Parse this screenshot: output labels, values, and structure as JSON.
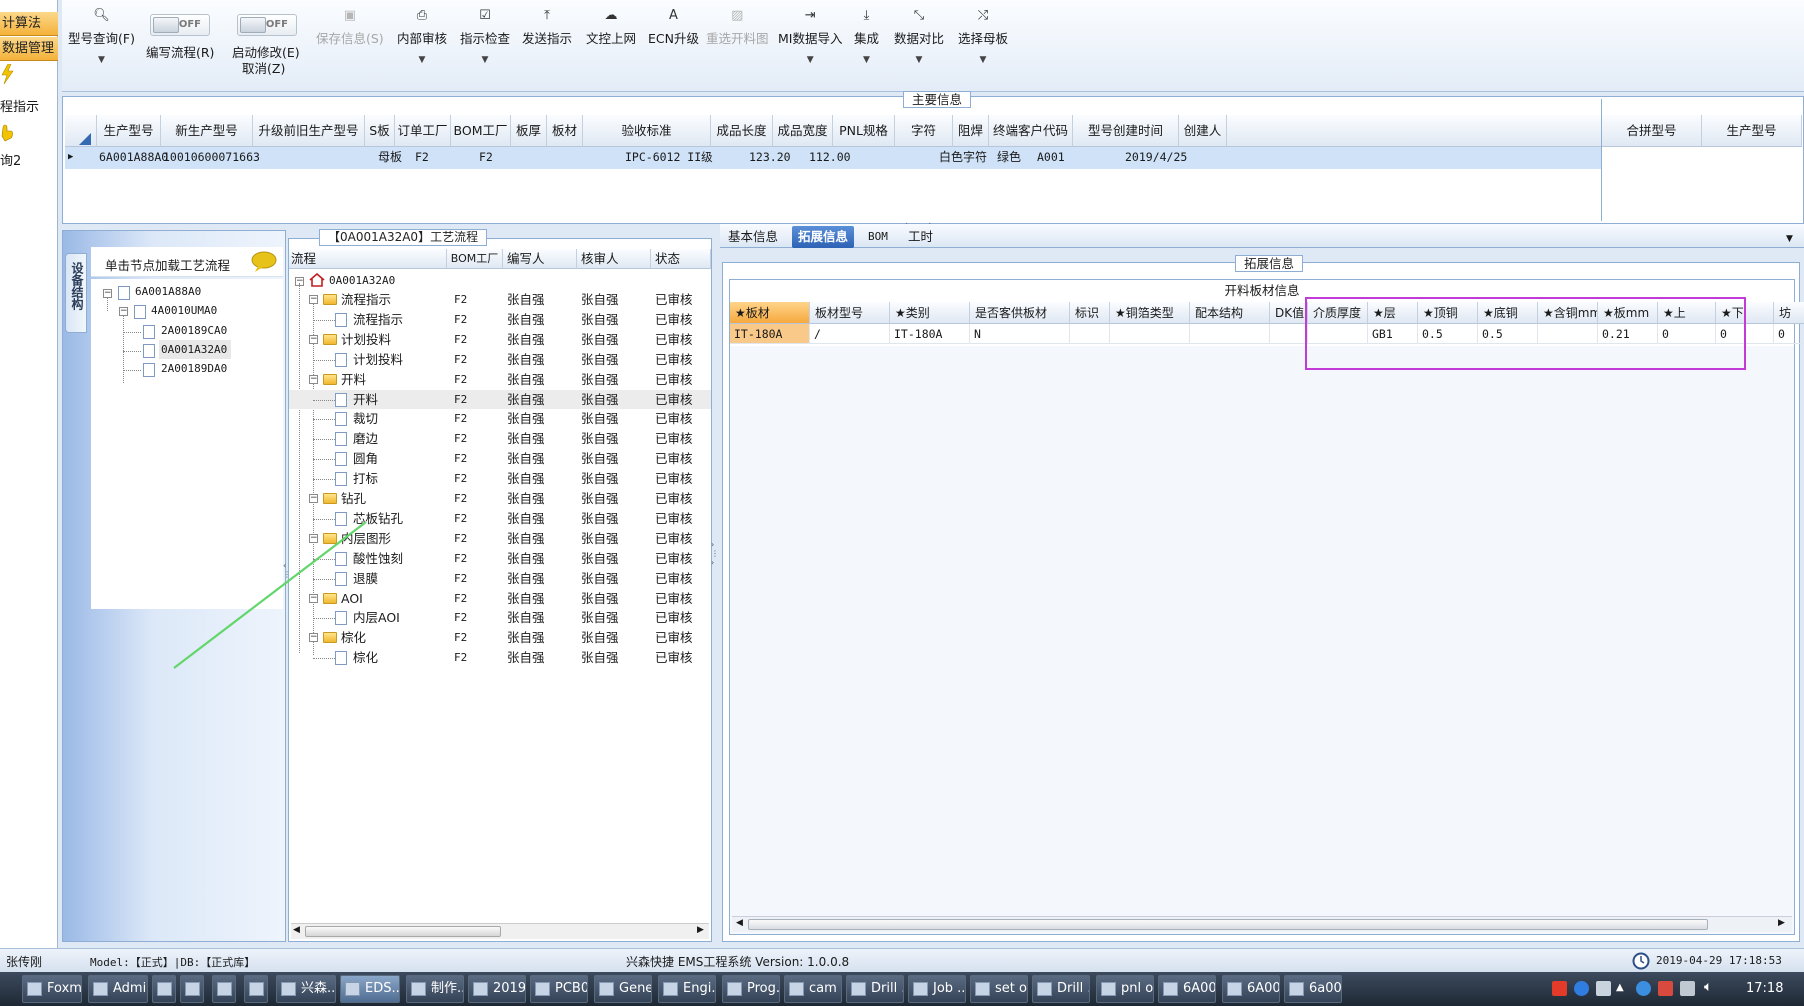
{
  "left_nav": {
    "btn1": "计算法",
    "btn2": "数据管理",
    "text1": "程指示",
    "text2": "询2"
  },
  "toolbar": {
    "items": [
      {
        "label": "型号查询(F)",
        "icon": "search-icon"
      },
      {
        "label": "编写流程(R)",
        "toggle": "OFF"
      },
      {
        "label": "启动修改(E)",
        "label2": "取消(Z)",
        "toggle": "OFF"
      },
      {
        "label": "保存信息(S)",
        "icon": "save-icon",
        "disabled": true
      },
      {
        "label": "内部审核",
        "icon": "printer-icon"
      },
      {
        "label": "指示检查",
        "icon": "check-icon"
      },
      {
        "label": "发送指示",
        "icon": "upload-icon"
      },
      {
        "label": "文控上网",
        "icon": "cloud-icon"
      },
      {
        "label": "ECN升级",
        "icon": "ecn-icon"
      },
      {
        "label": "重选开料图",
        "icon": "image-icon",
        "disabled": true
      },
      {
        "label": "MI数据导入",
        "icon": "import-icon"
      },
      {
        "label": "集成",
        "icon": "download-icon"
      },
      {
        "label": "数据对比",
        "icon": "compare-icon"
      },
      {
        "label": "选择母板",
        "icon": "shuffle-icon"
      }
    ]
  },
  "main_info": {
    "title": "主要信息",
    "headers": [
      "生产型号",
      "新生产型号",
      "升级前旧生产型号",
      "S板",
      "订单工厂",
      "BOM工厂",
      "板厚",
      "板材",
      "验收标准",
      "成品长度",
      "成品宽度",
      "PNL规格",
      "字符",
      "阻焊",
      "终端客户代码",
      "型号创建时间",
      "创建人"
    ],
    "row": {
      "prod_model": "6A001A88A0",
      "new_model": "10010600071663",
      "old_model": "",
      "s_board": "母板",
      "order_factory": "F2",
      "bom_factory": "F2",
      "thickness": "",
      "material": "",
      "standard": "IPC-6012 II级",
      "length": "123.20",
      "width": "112.00",
      "pnl": "",
      "char": "白色字符",
      "mask": "绿色",
      "customer": "A001",
      "created": "2019/4/25",
      "creator": ""
    },
    "side_headers": [
      "合拼型号",
      "生产型号"
    ]
  },
  "structure": {
    "side_tab": "设备结构",
    "hint": "单击节点加载工艺流程",
    "nodes": [
      "6A001A88A0",
      "4A0010UMA0",
      "2A00189CA0",
      "0A001A32A0",
      "2A00189DA0"
    ]
  },
  "flow": {
    "title": "【0A001A32A0】工艺流程",
    "headers": [
      "流程",
      "BOM工厂",
      "编写人",
      "核审人",
      "状态"
    ],
    "root": "0A001A32A0",
    "rows": [
      {
        "name": "流程指示",
        "bom": "F2",
        "writer": "张自强",
        "reviewer": "张自强",
        "status": "已审核"
      },
      {
        "name": "流程指示",
        "bom": "F2",
        "writer": "张自强",
        "reviewer": "张自强",
        "status": "已审核"
      },
      {
        "name": "计划投料",
        "bom": "F2",
        "writer": "张自强",
        "reviewer": "张自强",
        "status": "已审核"
      },
      {
        "name": "计划投料",
        "bom": "F2",
        "writer": "张自强",
        "reviewer": "张自强",
        "status": "已审核"
      },
      {
        "name": "开料",
        "bom": "F2",
        "writer": "张自强",
        "reviewer": "张自强",
        "status": "已审核"
      },
      {
        "name": "开料",
        "bom": "F2",
        "writer": "张自强",
        "reviewer": "张自强",
        "status": "已审核"
      },
      {
        "name": "裁切",
        "bom": "F2",
        "writer": "张自强",
        "reviewer": "张自强",
        "status": "已审核"
      },
      {
        "name": "磨边",
        "bom": "F2",
        "writer": "张自强",
        "reviewer": "张自强",
        "status": "已审核"
      },
      {
        "name": "圆角",
        "bom": "F2",
        "writer": "张自强",
        "reviewer": "张自强",
        "status": "已审核"
      },
      {
        "name": "打标",
        "bom": "F2",
        "writer": "张自强",
        "reviewer": "张自强",
        "status": "已审核"
      },
      {
        "name": "钻孔",
        "bom": "F2",
        "writer": "张自强",
        "reviewer": "张自强",
        "status": "已审核"
      },
      {
        "name": "芯板钻孔",
        "bom": "F2",
        "writer": "张自强",
        "reviewer": "张自强",
        "status": "已审核"
      },
      {
        "name": "内层图形",
        "bom": "F2",
        "writer": "张自强",
        "reviewer": "张自强",
        "status": "已审核"
      },
      {
        "name": "酸性蚀刻",
        "bom": "F2",
        "writer": "张自强",
        "reviewer": "张自强",
        "status": "已审核"
      },
      {
        "name": "退膜",
        "bom": "F2",
        "writer": "张自强",
        "reviewer": "张自强",
        "status": "已审核"
      },
      {
        "name": "AOI",
        "bom": "F2",
        "writer": "张自强",
        "reviewer": "张自强",
        "status": "已审核"
      },
      {
        "name": "内层AOI",
        "bom": "F2",
        "writer": "张自强",
        "reviewer": "张自强",
        "status": "已审核"
      },
      {
        "name": "棕化",
        "bom": "F2",
        "writer": "张自强",
        "reviewer": "张自强",
        "status": "已审核"
      },
      {
        "name": "棕化",
        "bom": "F2",
        "writer": "张自强",
        "reviewer": "张自强",
        "status": "已审核"
      }
    ]
  },
  "detail": {
    "tabs": [
      "基本信息",
      "拓展信息",
      "BOM",
      "工时"
    ],
    "group_title": "拓展信息",
    "table_title": "开料板材信息",
    "headers": [
      "★板材",
      "板材型号",
      "★类别",
      "是否客供板材",
      "标识",
      "★铜箔类型",
      "配本结构",
      "DK值",
      "介质厚度",
      "★层",
      "★顶铜",
      "★底铜",
      "★含铜mm",
      "★板mm",
      "★上",
      "★下",
      "坊"
    ],
    "row": [
      "IT-180A",
      "/",
      "IT-180A",
      "N",
      "",
      "",
      "",
      "",
      "",
      "GB1",
      "0.5",
      "0.5",
      "",
      "0.21",
      "0",
      "0",
      "0"
    ]
  },
  "status": {
    "user": "张传刚",
    "model": "Model:【正式】|DB:【正式库】",
    "system": "兴森快捷 EMS工程系统 Version: 1.0.0.8",
    "datetime": "2019-04-29 17:18:53"
  },
  "taskbar": {
    "items": [
      "Foxm...",
      "Admi...",
      "",
      "",
      "",
      "",
      "兴森...",
      "EDS...",
      "制作...",
      "2019...",
      "PCB0...",
      "Gene...",
      "Engi...",
      "Prog...",
      "cam ...",
      "Drill ...",
      "Job ...",
      "set o...",
      "Drill ...",
      "pnl o...",
      "6A00...",
      "6A00...",
      "6a00..."
    ],
    "clock": "17:18"
  },
  "colors": {
    "highlight_box": "#c23bd6",
    "selected_row": "#cfe2f7",
    "accent": "#2d62b5",
    "arrow_line": "#62d66a"
  }
}
